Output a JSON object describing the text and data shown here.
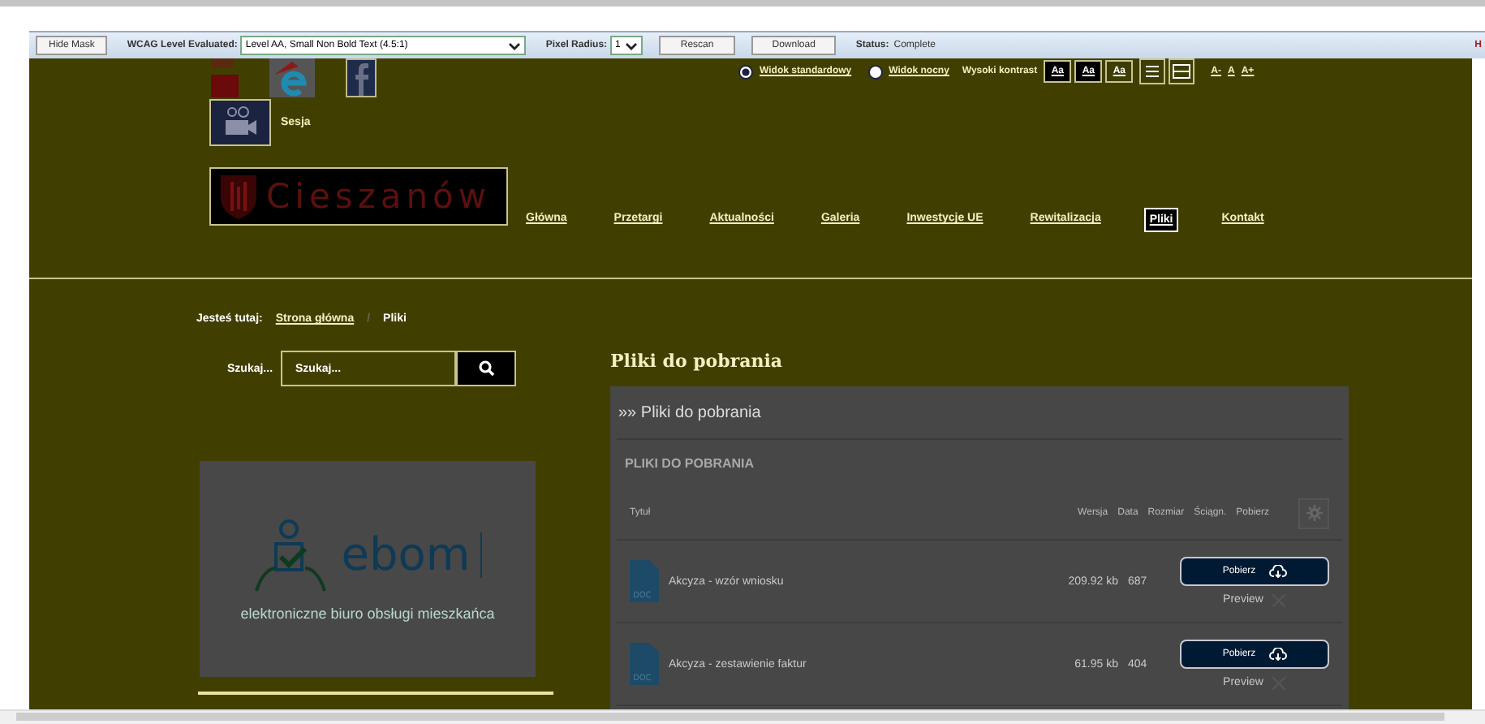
{
  "toolbar": {
    "hide_mask": "Hide Mask",
    "wcag_label": "WCAG Level Evaluated:",
    "wcag_value": "Level AA, Small Non Bold Text (4.5:1)",
    "radius_label": "Pixel Radius:",
    "radius_value": "1",
    "rescan": "Rescan",
    "download": "Download",
    "status_label": "Status:",
    "status_value": "Complete",
    "cut_link": "H"
  },
  "accessibility": {
    "views": [
      {
        "label": "Widok standardowy",
        "selected": true
      },
      {
        "label": "Widok nocny",
        "selected": false
      }
    ],
    "contrast_label": "Wysoki kontrast",
    "contrast_options": [
      {
        "label": "Aa",
        "selected": false
      },
      {
        "label": "Aa",
        "selected": false
      },
      {
        "label": "Aa",
        "selected": true
      }
    ],
    "font_sizes": [
      "A-",
      "A",
      "A+"
    ]
  },
  "session_label": "Sesja",
  "logo": "Cieszanów",
  "nav": [
    {
      "label": "Główna",
      "selected": false
    },
    {
      "label": "Przetargi",
      "selected": false
    },
    {
      "label": "Aktualności",
      "selected": false
    },
    {
      "label": "Galeria",
      "selected": false
    },
    {
      "label": "Inwestycje UE",
      "selected": false
    },
    {
      "label": "Rewitalizacja",
      "selected": false
    },
    {
      "label": "Pliki",
      "selected": true
    },
    {
      "label": "Kontakt",
      "selected": false
    }
  ],
  "breadcrumb": {
    "label": "Jesteś tutaj:",
    "items": [
      "Strona główna",
      "Pliki"
    ],
    "separator": "/"
  },
  "search": {
    "label": "Szukaj...",
    "placeholder": "Szukaj..."
  },
  "banner": {
    "title": "ebom",
    "subtitle": "elektroniczne biuro obsługi mieszkańca"
  },
  "files": {
    "heading": "Pliki do pobrania",
    "panel_title": "»» Pliki do pobrania",
    "section": "PLIKI DO POBRANIA",
    "columns": [
      "Tytuł",
      "Wersja",
      "Data",
      "Rozmiar",
      "Ściągn.",
      "Pobierz"
    ],
    "rows": [
      {
        "file_type": "DOC",
        "title": "Akcyza - wzór wniosku",
        "size": "209.92 kb",
        "downloads": "687",
        "button": "Pobierz",
        "preview": "Preview"
      },
      {
        "file_type": "DOC",
        "title": "Akcyza - zestawienie faktur",
        "size": "61.95 kb",
        "downloads": "404",
        "button": "Pobierz",
        "preview": "Preview"
      }
    ]
  }
}
